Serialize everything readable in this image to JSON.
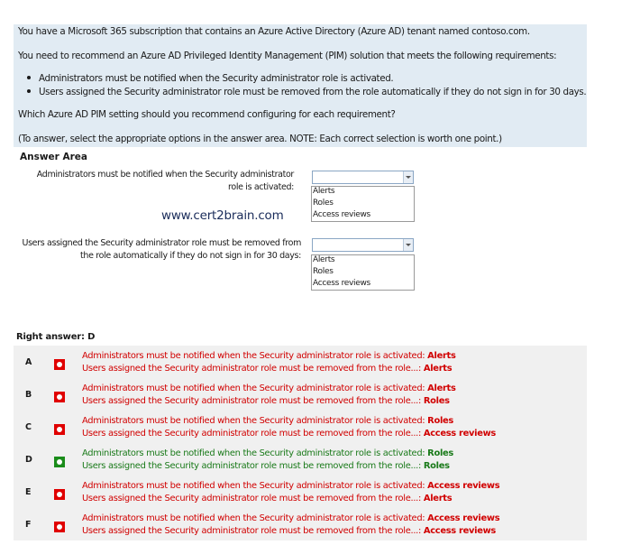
{
  "question": {
    "line1": "You have a Microsoft 365 subscription that contains an Azure Active Directory (Azure AD) tenant named contoso.com.",
    "line2": "You need to recommend an Azure AD Privileged Identity Management (PIM) solution that meets the following requirements:",
    "bullets": [
      "Administrators must be notified when the Security administrator role is activated.",
      "Users assigned the Security administrator role must be removed from the role automatically if they do not sign in for 30 days."
    ],
    "line3": "Which Azure AD PIM setting should you recommend configuring for each requirement?",
    "line4": "(To answer, select the appropriate options in the answer area. NOTE: Each correct selection is worth one point.)"
  },
  "answer_area": {
    "title": "Answer Area",
    "req1_line1": "Administrators must be notified when the Security administrator",
    "req1_line2": "role is activated:",
    "req2_line1": "Users assigned the Security administrator role must be removed from",
    "req2_line2": "the role automatically if they do not sign in for 30 days:",
    "dropdown_options": [
      "Alerts",
      "Roles",
      "Access reviews"
    ]
  },
  "watermark": "www.cert2brain.com",
  "right_answer_label": "Right answer: D",
  "options": [
    {
      "letter": "A",
      "correct": false,
      "line1_prefix": "Administrators must be notified when the Security administrator role is activated: ",
      "line1_value": "Alerts",
      "line2_prefix": "Users assigned the Security administrator role must be removed from the role...: ",
      "line2_value": "Alerts"
    },
    {
      "letter": "B",
      "correct": false,
      "line1_prefix": "Administrators must be notified when the Security administrator role is activated: ",
      "line1_value": "Alerts",
      "line2_prefix": "Users assigned the Security administrator role must be removed from the role...: ",
      "line2_value": "Roles"
    },
    {
      "letter": "C",
      "correct": false,
      "line1_prefix": "Administrators must be notified when the Security administrator role is activated: ",
      "line1_value": "Roles",
      "line2_prefix": "Users assigned the Security administrator role must be removed from the role...: ",
      "line2_value": "Access reviews"
    },
    {
      "letter": "D",
      "correct": true,
      "line1_prefix": "Administrators must be notified when the Security administrator role is activated: ",
      "line1_value": "Roles",
      "line2_prefix": "Users assigned the Security administrator role must be removed from the role...: ",
      "line2_value": "Roles"
    },
    {
      "letter": "E",
      "correct": false,
      "line1_prefix": "Administrators must be notified when the Security administrator role is activated: ",
      "line1_value": "Access reviews",
      "line2_prefix": "Users assigned the Security administrator role must be removed from the role...: ",
      "line2_value": "Alerts"
    },
    {
      "letter": "F",
      "correct": false,
      "line1_prefix": "Administrators must be notified when the Security administrator role is activated: ",
      "line1_value": "Access reviews",
      "line2_prefix": "Users assigned the Security administrator role must be removed from the role...: ",
      "line2_value": "Access reviews"
    }
  ],
  "colors": {
    "question_bg": "#e1ebf3",
    "options_bg": "#f0f0f0",
    "wrong": "#d10000",
    "correct": "#1a7a1a"
  }
}
